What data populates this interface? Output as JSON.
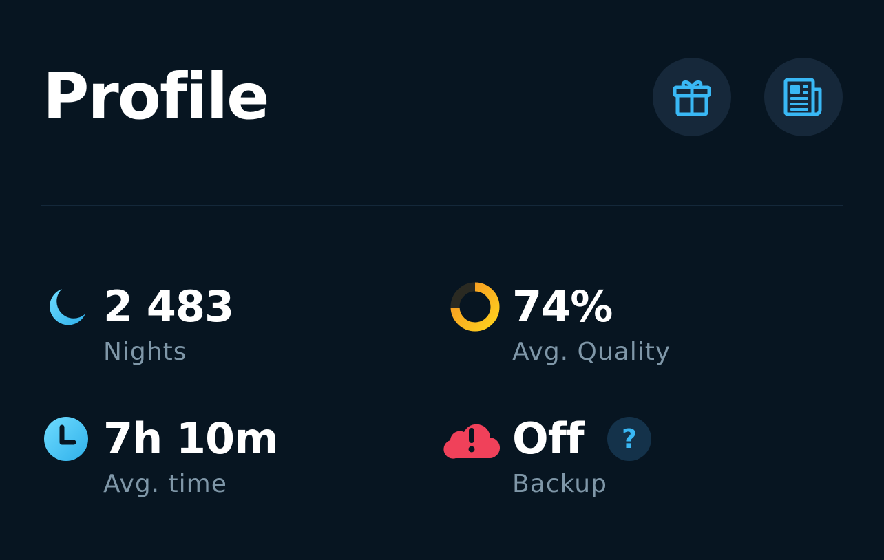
{
  "header": {
    "title": "Profile",
    "gift_icon": "gift-icon",
    "news_icon": "newspaper-icon"
  },
  "stats": {
    "nights": {
      "value": "2 483",
      "label": "Nights",
      "icon": "moon-icon"
    },
    "quality": {
      "value": "74%",
      "label": "Avg. Quality",
      "icon": "quality-ring-icon",
      "fraction": 0.74
    },
    "time": {
      "value": "7h 10m",
      "label": "Avg. time",
      "icon": "clock-icon"
    },
    "backup": {
      "value": "Off",
      "label": "Backup",
      "icon": "cloud-alert-icon",
      "help": "?"
    }
  },
  "colors": {
    "background": "#071521",
    "accent_blue": "#39b8f5",
    "quality_orange": "#f5a623",
    "alert_red": "#f0415a",
    "label_gray": "#7f97a8"
  }
}
